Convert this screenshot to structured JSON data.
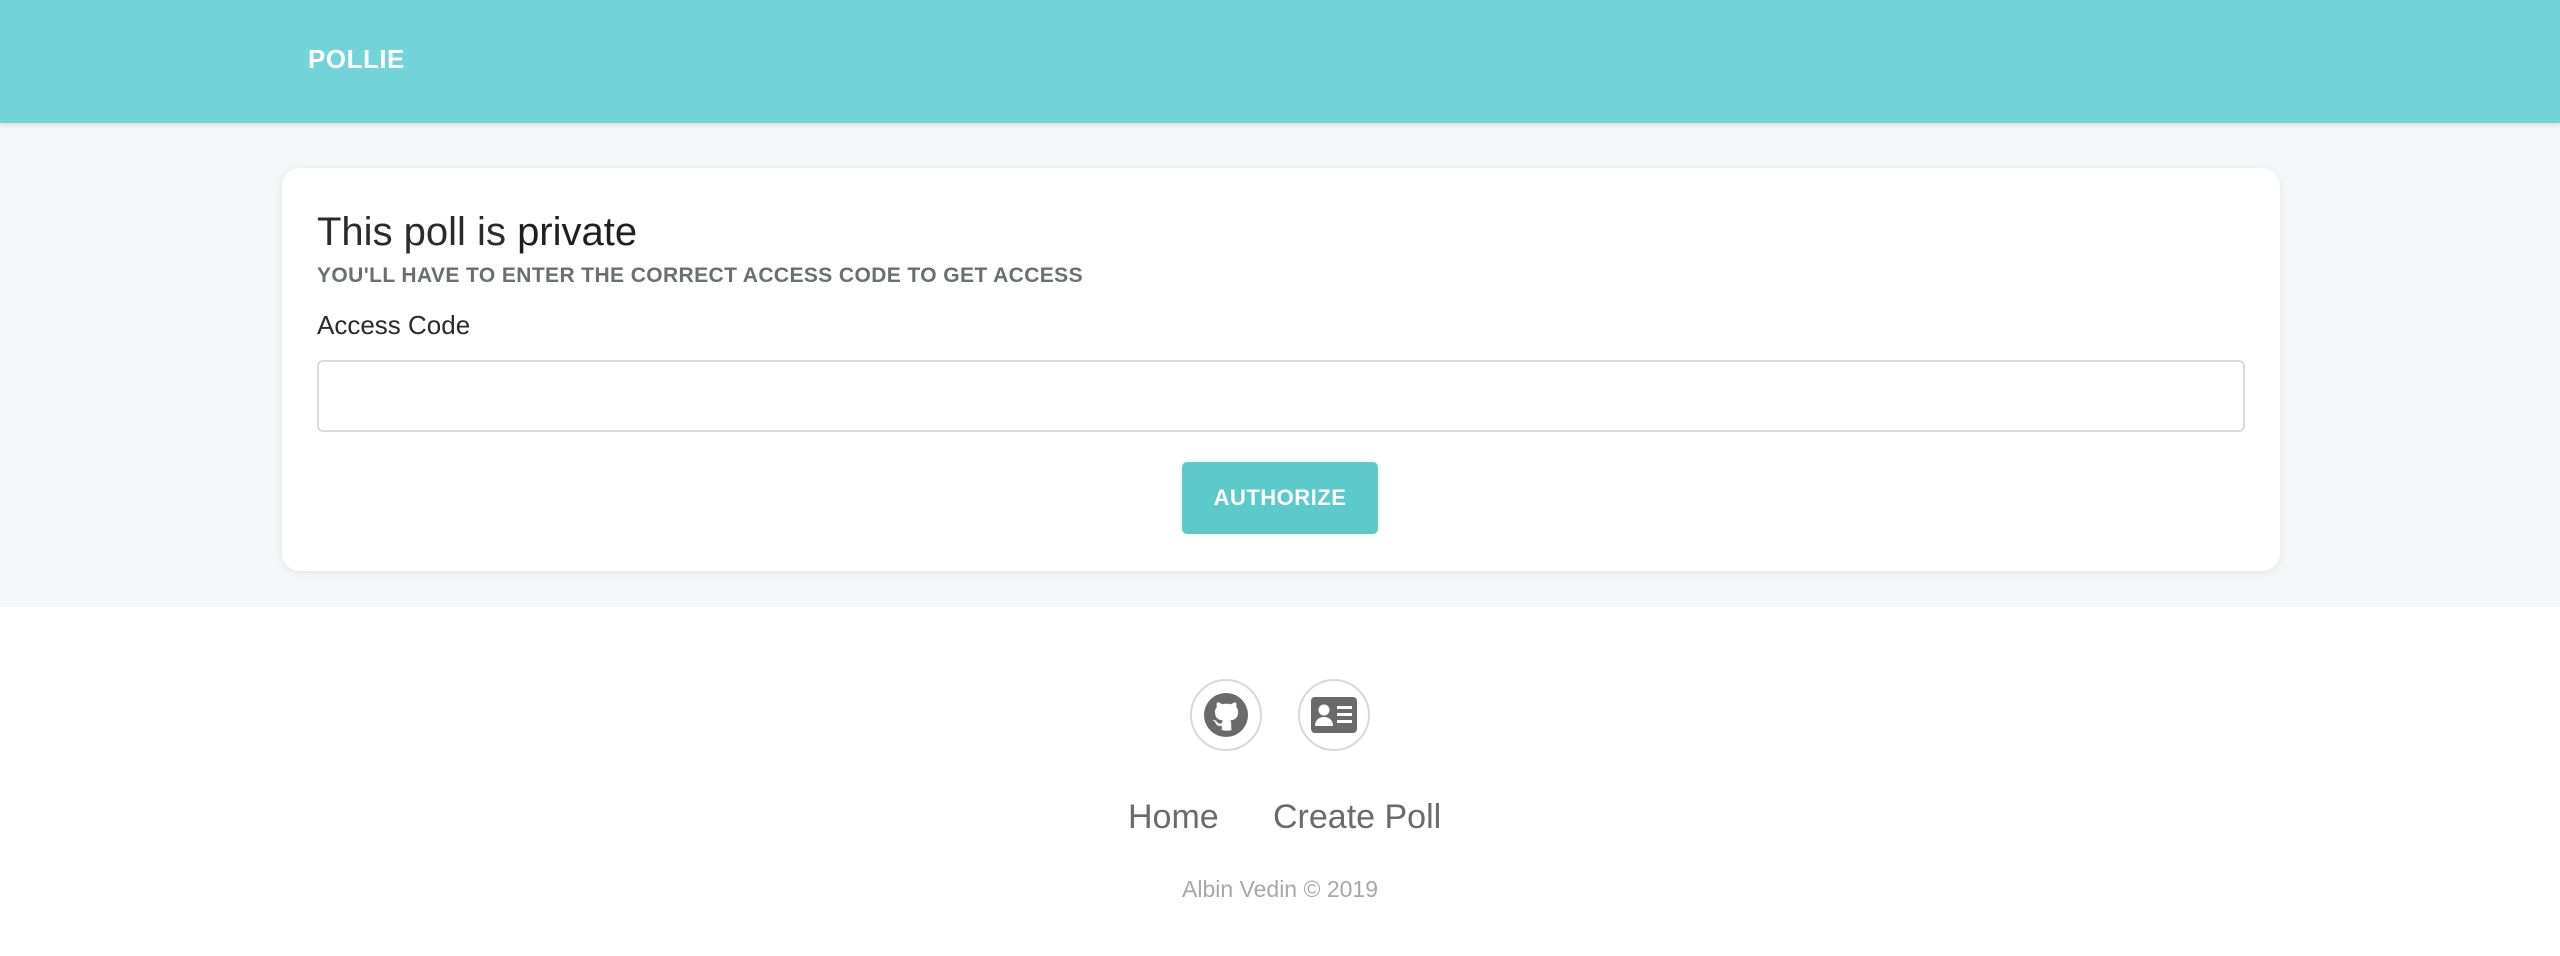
{
  "navbar": {
    "brand": "POLLIE",
    "background_color": "#72d4d8"
  },
  "card": {
    "title_prefix": "This poll is ",
    "title_emphasis": "private",
    "subtitle": "YOU'LL HAVE TO ENTER THE CORRECT ACCESS CODE TO GET ACCESS",
    "field_label": "Access Code",
    "input_value": "",
    "input_placeholder": "",
    "authorize_label": "AUTHORIZE",
    "accent_color": "#5ccacb"
  },
  "footer": {
    "icons": [
      {
        "name": "github-icon"
      },
      {
        "name": "id-card-icon"
      }
    ],
    "links": [
      "Home",
      "Create Poll"
    ],
    "copyright": "Albin Vedin © 2019"
  }
}
